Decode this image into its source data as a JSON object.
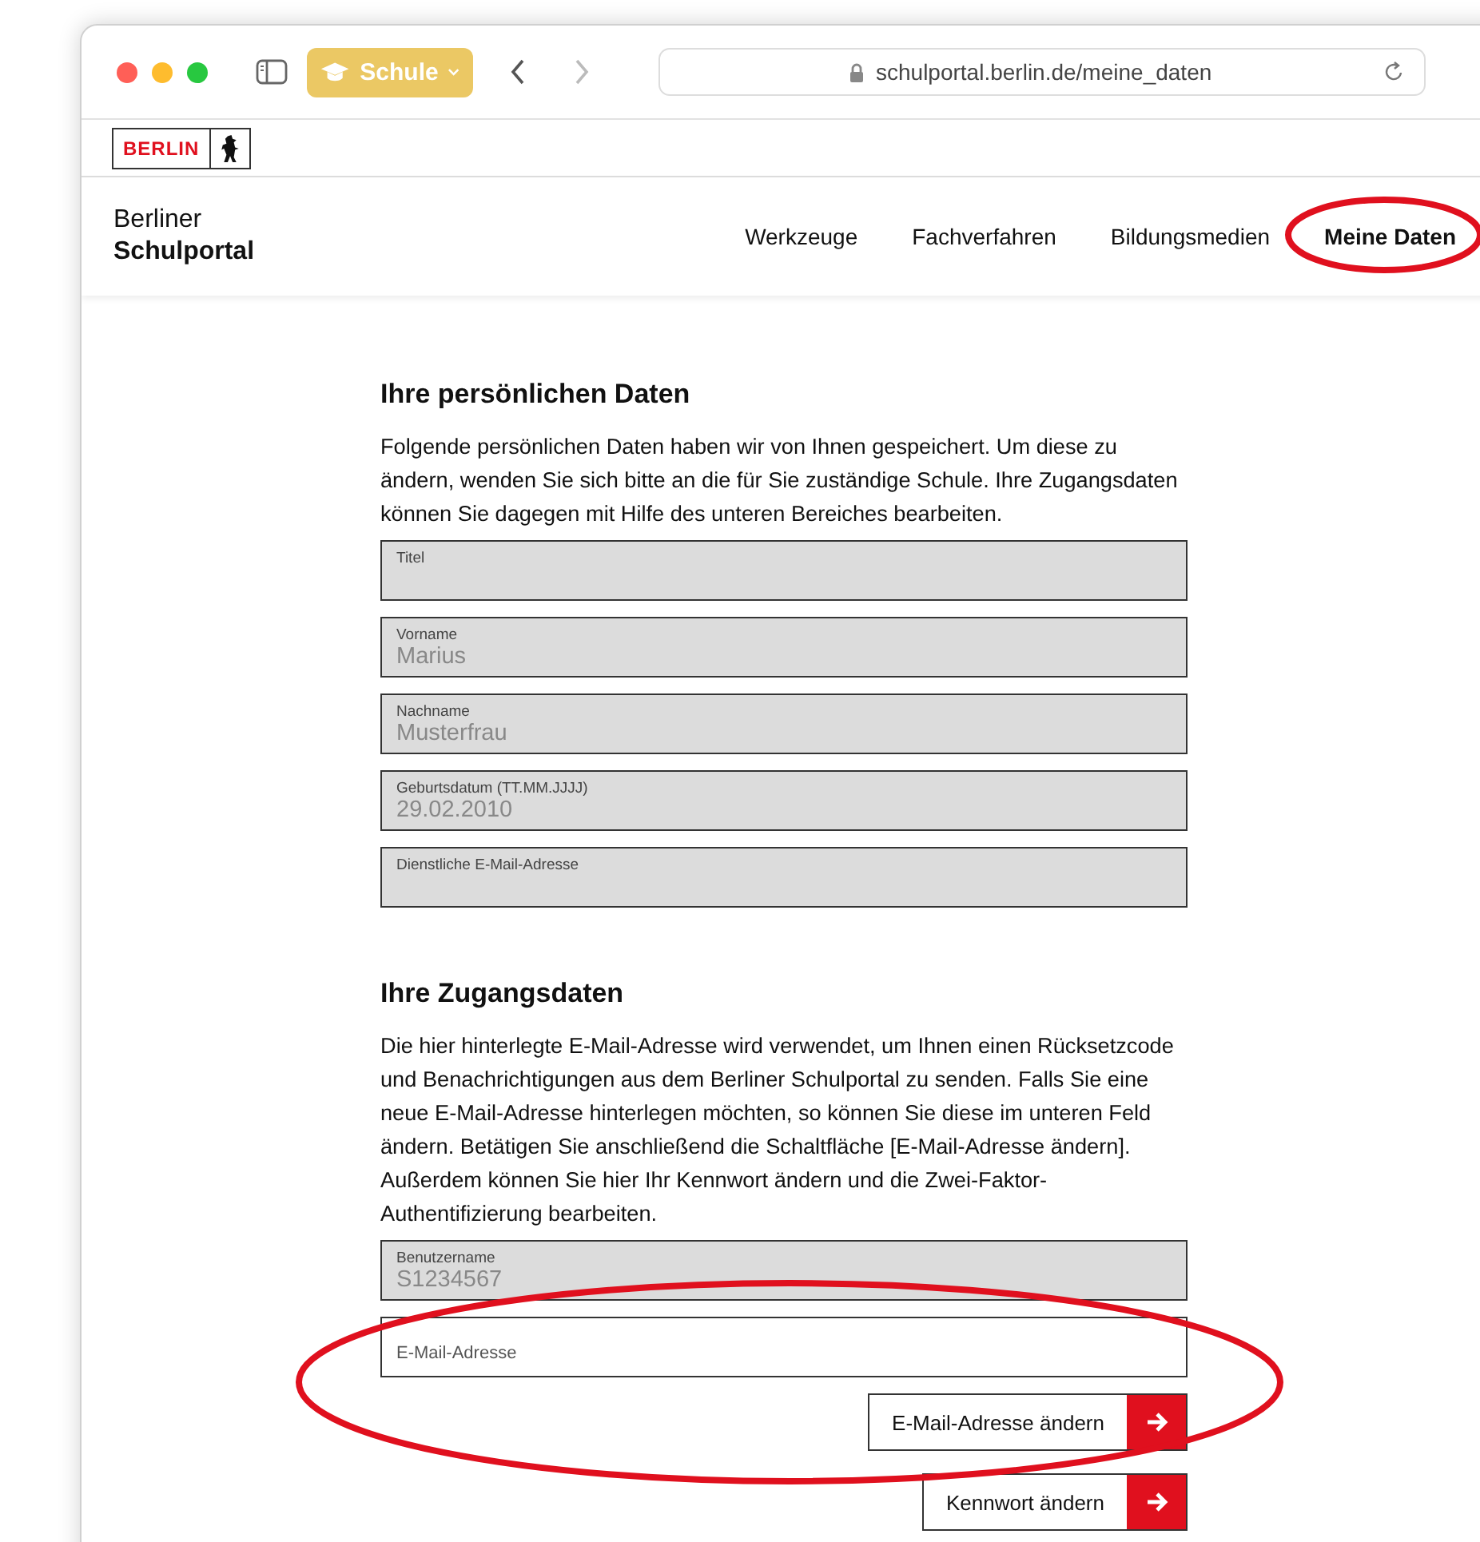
{
  "browser": {
    "tab_group": "Schule",
    "url": "schulportal.berlin.de/meine_daten",
    "back_disabled": false,
    "forward_disabled": true
  },
  "logo": {
    "text": "BERLIN"
  },
  "site": {
    "title_line1": "Berliner",
    "title_line2": "Schulportal"
  },
  "nav": [
    {
      "label": "Werkzeuge",
      "selected": false
    },
    {
      "label": "Fachverfahren",
      "selected": false
    },
    {
      "label": "Bildungsmedien",
      "selected": false
    },
    {
      "label": "Meine Daten",
      "selected": true
    }
  ],
  "sections": [
    {
      "heading": "Ihre persönlichen Daten",
      "text": "Folgende persönlichen Daten haben wir von Ihnen gespeichert. Um diese zu ändern, wenden Sie sich bitte an die für Sie zuständige Schule. Ihre Zugangsdaten können Sie dagegen mit Hilfe des unteren Bereiches bearbeiten.",
      "fields": [
        {
          "kind": "readonly",
          "label": "Titel"
        },
        {
          "kind": "readonly",
          "label": "Vorname",
          "value": "Marius"
        },
        {
          "kind": "readonly",
          "label": "Nachname",
          "value": "Musterfrau"
        },
        {
          "kind": "readonly",
          "label": "Geburtsdatum (TT.MM.JJJJ)",
          "value": "29.02.2010"
        },
        {
          "kind": "readonly",
          "label": "Dienstliche E-Mail-Adresse"
        }
      ]
    },
    {
      "heading": "Ihre Zugangsdaten",
      "text": "Die hier hinterlegte E-Mail-Adresse wird verwendet, um Ihnen einen Rücksetzcode und Benachrichtigungen aus dem Berliner Schulportal zu senden. Falls Sie eine neue E-Mail-Adresse hinterlegen möchten, so können Sie diese im unteren Feld ändern. Betätigen Sie anschließend die Schaltfläche [E-Mail-Adresse ändern]. Außerdem können Sie hier Ihr Kennwort ändern und die Zwei-Faktor-Authentifizierung bearbeiten.",
      "fields": [
        {
          "kind": "readonly",
          "label": "Benutzername",
          "value": "S1234567"
        },
        {
          "kind": "input",
          "placeholder": "E-Mail-Adresse"
        }
      ],
      "buttons": [
        {
          "label": "E-Mail-Adresse ändern"
        },
        {
          "label": "Kennwort ändern"
        }
      ]
    }
  ]
}
